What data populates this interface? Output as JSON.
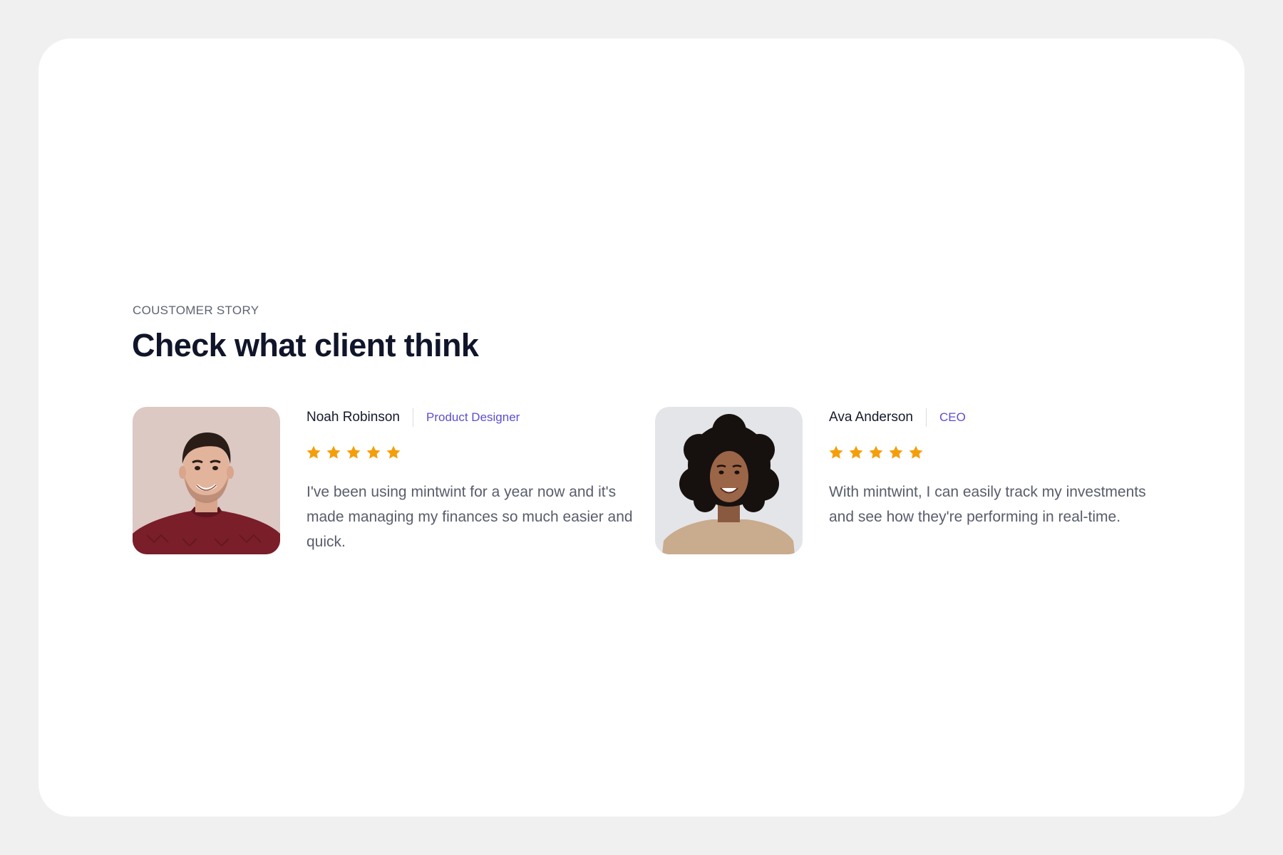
{
  "section": {
    "eyebrow": "COUSTOMER STORY",
    "title": "Check what client think"
  },
  "colors": {
    "background": "#f0f0f0",
    "card": "#ffffff",
    "heading": "#11152a",
    "role": "#5b4ed0",
    "star": "#f59e0b",
    "body_text": "#595d6b"
  },
  "testimonials": [
    {
      "name": "Noah Robinson",
      "role": "Product Designer",
      "rating": 5,
      "rating_max": 5,
      "quote": "I've been using mintwint for a year now and it's made managing my finances so much easier and quick."
    },
    {
      "name": "Ava Anderson",
      "role": "CEO",
      "rating": 5,
      "rating_max": 5,
      "quote": "With mintwint, I can easily track my investments and see how they're performing in real-time."
    }
  ],
  "icons": {
    "star": "star-icon"
  }
}
